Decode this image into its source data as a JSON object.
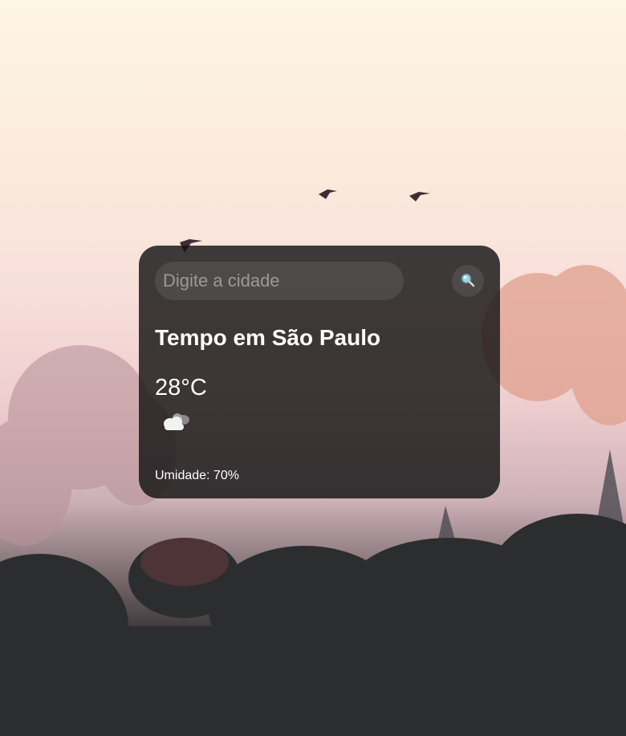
{
  "search": {
    "placeholder": "Digite a cidade",
    "button_icon": "magnifier-icon"
  },
  "weather": {
    "title": "Tempo em São Paulo",
    "temperature": "28°C",
    "icon": "cloud-icon",
    "humidity": "Umidade: 70%"
  },
  "background": {
    "description_icon": "misty-forest-birds-photo"
  }
}
